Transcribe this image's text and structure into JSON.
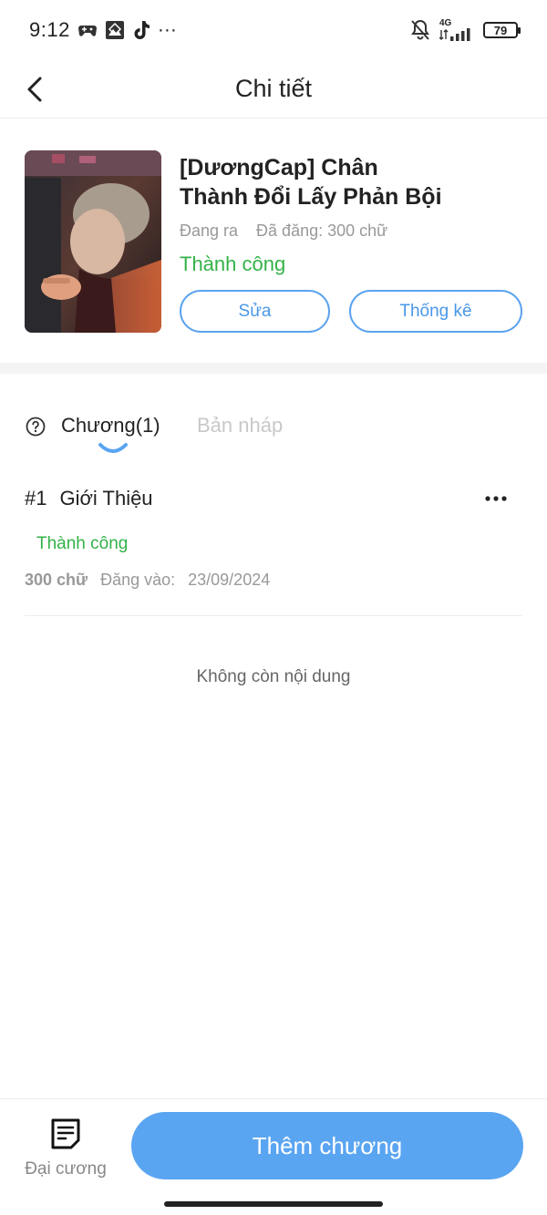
{
  "status_bar": {
    "time": "9:12",
    "network": "4G",
    "battery": "79",
    "overflow": "···"
  },
  "header": {
    "title": "Chi tiết"
  },
  "book": {
    "title_line1": "[DươngCap] Chân",
    "title_line2": "Thành Đổi Lấy Phản Bội",
    "publish_state": "Đang ra",
    "word_count": "Đã đăng: 300 chữ",
    "status": "Thành công",
    "edit_label": "Sửa",
    "stats_label": "Thống kê"
  },
  "tabs": {
    "chapters": "Chương(1)",
    "drafts": "Bản nháp",
    "active": "chapters"
  },
  "chapters": [
    {
      "number": "#1",
      "title": "Giới Thiệu",
      "status": "Thành công",
      "words": "300 chữ",
      "posted_label": "Đăng vào:",
      "posted_date": "23/09/2024"
    }
  ],
  "empty_text": "Không còn nội dung",
  "bottom_bar": {
    "outline_label": "Đại cương",
    "add_chapter_label": "Thêm chương"
  },
  "colors": {
    "accent": "#5aa5f1",
    "success": "#33b248",
    "muted": "#999999"
  }
}
